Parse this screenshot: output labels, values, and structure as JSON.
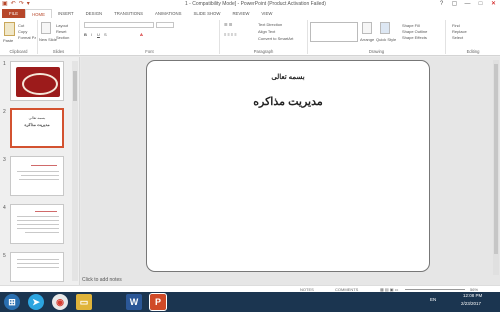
{
  "window": {
    "title": "1 - Compatibility Mode] - PowerPoint (Product Activation Failed)",
    "quick_access": [
      "save-icon",
      "undo-icon",
      "redo-icon",
      "customize-icon"
    ],
    "controls": [
      "?",
      "▢",
      "—",
      "□",
      "✕"
    ]
  },
  "tabs": [
    "FILE",
    "HOME",
    "INSERT",
    "DESIGN",
    "TRANSITIONS",
    "ANIMATIONS",
    "SLIDE SHOW",
    "REVIEW",
    "VIEW"
  ],
  "ribbon": {
    "groups": [
      "Clipboard",
      "Slides",
      "Font",
      "Paragraph",
      "Drawing",
      "Editing"
    ],
    "clipboard": {
      "paste": "Paste",
      "cut": "Cut",
      "copy": "Copy",
      "format_painter": "Format Painter"
    },
    "slides": {
      "new_slide": "New Slide",
      "layout": "Layout",
      "reset": "Reset",
      "section": "Section"
    },
    "paragraph": {
      "text_direction": "Text Direction",
      "align_text": "Align Text",
      "smartart": "Convert to SmartArt"
    },
    "drawing": {
      "arrange": "Arrange",
      "quick_styles": "Quick Styles",
      "shape_fill": "Shape Fill",
      "shape_outline": "Shape Outline",
      "shape_effects": "Shape Effects"
    },
    "editing": {
      "find": "Find",
      "replace": "Replace",
      "select": "Select"
    }
  },
  "thumbnails": [
    {
      "number": "1"
    },
    {
      "number": "2",
      "title": "بسمه تعالی",
      "subtitle": "مدیریت مذاکره",
      "selected": true
    },
    {
      "number": "3"
    },
    {
      "number": "4"
    },
    {
      "number": "5"
    }
  ],
  "slide": {
    "title": "بسمه تعالی",
    "heading": "مدیریت مذاکره"
  },
  "notes_placeholder": "Click to add notes",
  "status": {
    "notes": "NOTES",
    "comments": "COMMENTS",
    "zoom": "56%"
  },
  "taskbar": {
    "apps": [
      "start",
      "telegram",
      "chrome",
      "explorer",
      "word",
      "powerpoint"
    ],
    "language": "EN",
    "time": "12:08 PM",
    "date": "2/23/2017"
  }
}
